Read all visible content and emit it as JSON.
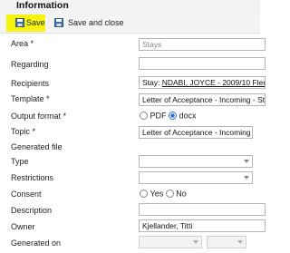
{
  "header": {
    "title": "Information"
  },
  "toolbar": {
    "save_label": "Save",
    "save_close_label": "Save and close",
    "highlight_color": "#f5f50f"
  },
  "form": {
    "area": {
      "label": "Area *",
      "value": "Stays"
    },
    "regarding": {
      "label": "Regarding",
      "value": ""
    },
    "recipients": {
      "label": "Recipients",
      "prefix": "Stay: ",
      "link": "NDABI, JOYCE - 2009/10",
      "suffix": " Flem"
    },
    "template": {
      "label": "Template *",
      "value": "Letter of Acceptance - Incoming - St"
    },
    "output_format": {
      "label": "Output format *",
      "options": [
        "PDF",
        "docx"
      ],
      "selected": "docx"
    },
    "topic": {
      "label": "Topic *",
      "value": "Letter of Acceptance - Incoming -"
    },
    "generated_file": {
      "label": "Generated file"
    },
    "type": {
      "label": "Type",
      "value": ""
    },
    "restrictions": {
      "label": "Restrictions",
      "value": ""
    },
    "consent": {
      "label": "Consent",
      "options": [
        "Yes",
        "No"
      ]
    },
    "description": {
      "label": "Description",
      "value": ""
    },
    "owner": {
      "label": "Owner",
      "value": "Kjellander, Titti"
    },
    "generated_on": {
      "label": "Generated on",
      "value": ""
    }
  }
}
